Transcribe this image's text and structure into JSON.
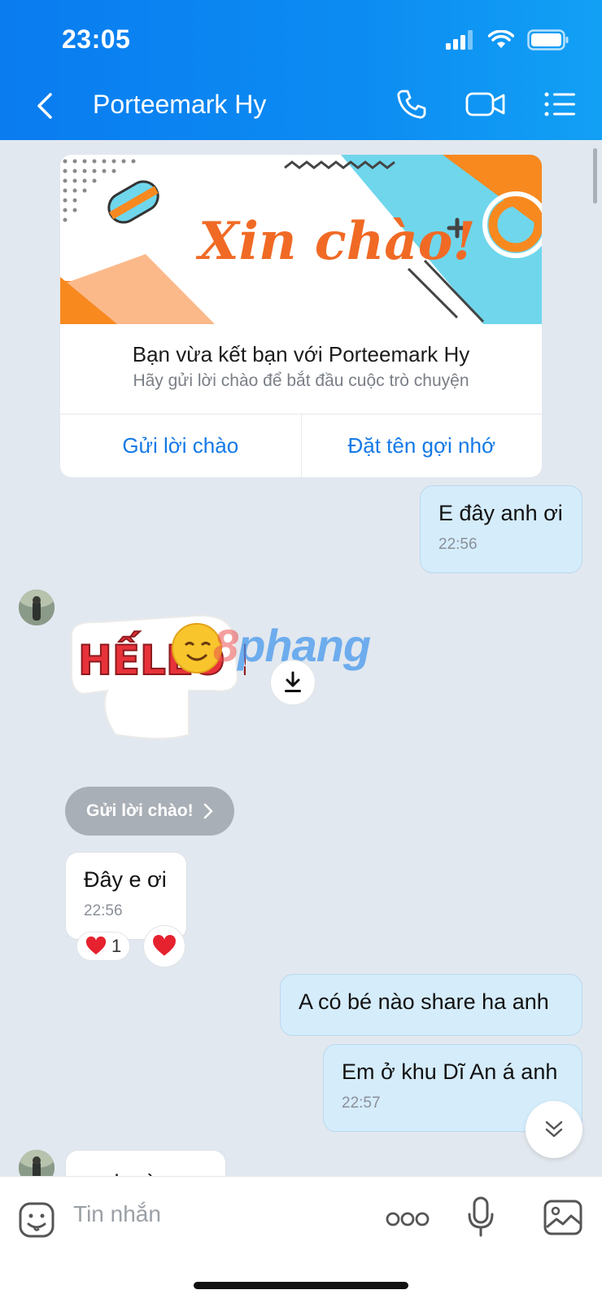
{
  "status": {
    "time": "23:05"
  },
  "header": {
    "title": "Porteemark Hy"
  },
  "greeting": {
    "banner_text": "Xin chào!",
    "title": "Bạn vừa kết bạn với Porteemark Hy",
    "subtitle": "Hãy gửi lời chào để bắt đầu cuộc trò chuyện",
    "action_left": "Gửi lời chào",
    "action_right": "Đặt tên gợi nhớ"
  },
  "messages": [
    {
      "from": "me",
      "text": "E đây anh ơi",
      "time": "22:56"
    },
    {
      "from": "them",
      "text": "Đây e ơi",
      "time": "22:56"
    },
    {
      "from": "me",
      "text": "A có bé nào share ha anh"
    },
    {
      "from": "me",
      "text": "Em ở khu Dĩ An á anh",
      "time": "22:57"
    },
    {
      "from": "them",
      "text": "mạh nào ợ"
    }
  ],
  "sticker": {
    "text": "HẾLLO !!!",
    "watermark": "8phang"
  },
  "chip": {
    "label": "Gửi lời chào!"
  },
  "reaction": {
    "count": "1"
  },
  "input": {
    "placeholder": "Tin nhắn"
  },
  "colors": {
    "accent": "#0c87f0",
    "bubble_me": "#d5ecfb",
    "bubble_them": "#ffffff",
    "background": "#e2e8ef"
  }
}
